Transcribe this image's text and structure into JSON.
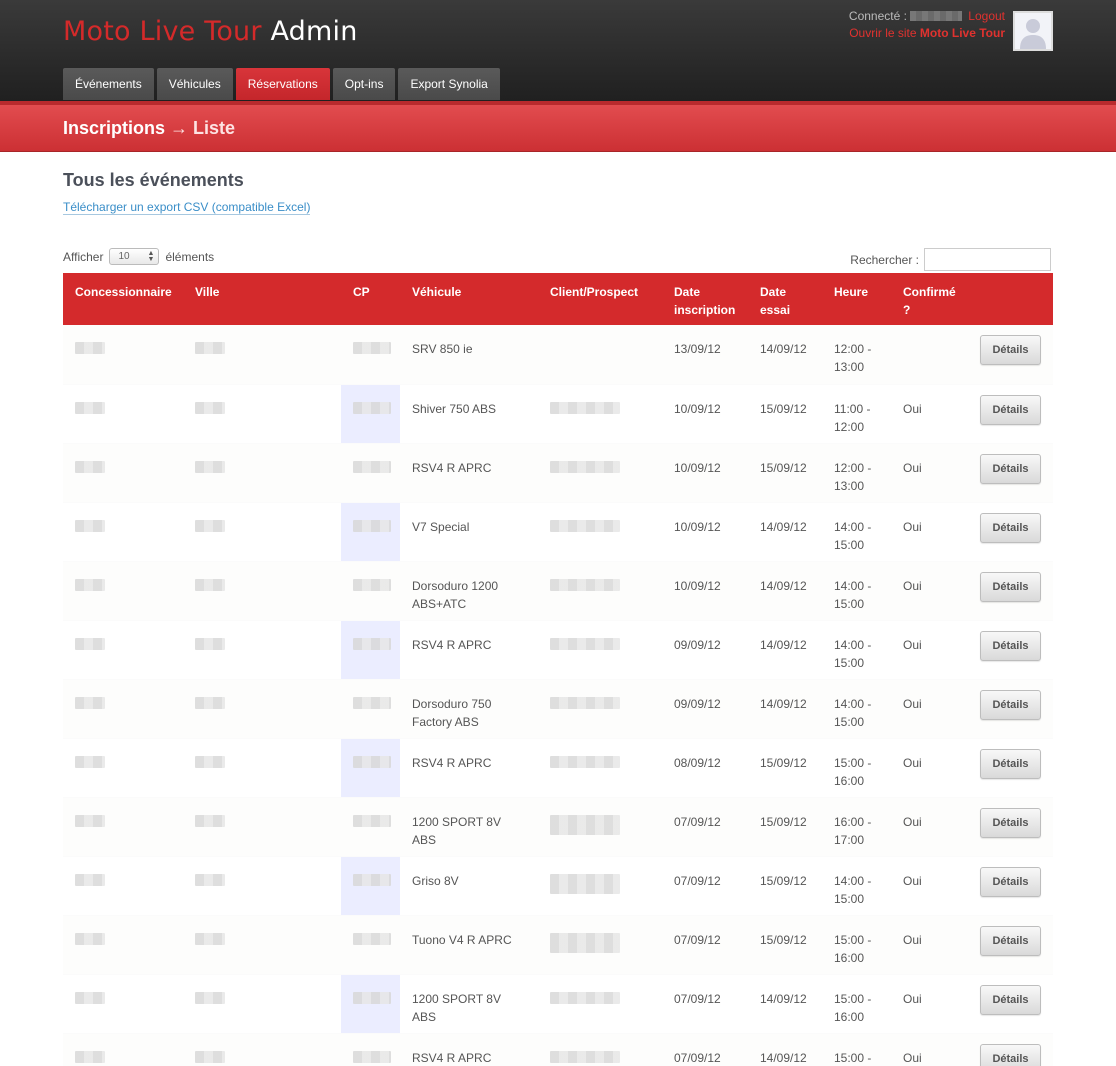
{
  "header": {
    "logo_brand": "Moto Live Tour",
    "logo_suffix": "Admin",
    "connected_label": "Connecté :",
    "logout_label": "Logout",
    "open_site_prefix": "Ouvrir le site",
    "open_site_name": "Moto Live Tour"
  },
  "nav": {
    "tabs": [
      {
        "label": "Événements",
        "active": false
      },
      {
        "label": "Véhicules",
        "active": false
      },
      {
        "label": "Réservations",
        "active": true
      },
      {
        "label": "Opt-ins",
        "active": false
      },
      {
        "label": "Export Synolia",
        "active": false
      }
    ]
  },
  "band": {
    "title": "Inscriptions",
    "arrow": "→",
    "subtitle": "Liste"
  },
  "section": {
    "title": "Tous les événements",
    "csv_link": "Télécharger un export CSV (compatible Excel)"
  },
  "controls": {
    "show_label": "Afficher",
    "show_value": "10",
    "items_label": "éléments",
    "search_label": "Rechercher :"
  },
  "table": {
    "columns": [
      "Concessionnaire",
      "Ville",
      "CP",
      "Véhicule",
      "Client/Prospect",
      "Date inscription",
      "Date essai",
      "Heure",
      "Confirmé ?",
      ""
    ],
    "details_label": "Détails",
    "rows": [
      {
        "vehicle": "SRV 850 ie",
        "date_inscription": "13/09/12",
        "date_essai": "14/09/12",
        "heure": "12:00 - 13:00",
        "confirme": "",
        "client_hidden": false
      },
      {
        "vehicle": "Shiver 750 ABS",
        "date_inscription": "10/09/12",
        "date_essai": "15/09/12",
        "heure": "11:00 - 12:00",
        "confirme": "Oui",
        "client_hidden": true
      },
      {
        "vehicle": "RSV4 R APRC",
        "date_inscription": "10/09/12",
        "date_essai": "15/09/12",
        "heure": "12:00 - 13:00",
        "confirme": "Oui",
        "client_hidden": true
      },
      {
        "vehicle": "V7 Special",
        "date_inscription": "10/09/12",
        "date_essai": "14/09/12",
        "heure": "14:00 - 15:00",
        "confirme": "Oui",
        "client_hidden": true
      },
      {
        "vehicle": "Dorsoduro 1200 ABS+ATC",
        "date_inscription": "10/09/12",
        "date_essai": "14/09/12",
        "heure": "14:00 - 15:00",
        "confirme": "Oui",
        "client_hidden": true
      },
      {
        "vehicle": "RSV4 R APRC",
        "date_inscription": "09/09/12",
        "date_essai": "14/09/12",
        "heure": "14:00 - 15:00",
        "confirme": "Oui",
        "client_hidden": true
      },
      {
        "vehicle": "Dorsoduro 750 Factory ABS",
        "date_inscription": "09/09/12",
        "date_essai": "14/09/12",
        "heure": "14:00 - 15:00",
        "confirme": "Oui",
        "client_hidden": true
      },
      {
        "vehicle": "RSV4 R APRC",
        "date_inscription": "08/09/12",
        "date_essai": "15/09/12",
        "heure": "15:00 - 16:00",
        "confirme": "Oui",
        "client_hidden": true
      },
      {
        "vehicle": "1200 SPORT 8V ABS",
        "date_inscription": "07/09/12",
        "date_essai": "15/09/12",
        "heure": "16:00 - 17:00",
        "confirme": "Oui",
        "client_hidden": true
      },
      {
        "vehicle": "Griso 8V",
        "date_inscription": "07/09/12",
        "date_essai": "15/09/12",
        "heure": "14:00 - 15:00",
        "confirme": "Oui",
        "client_hidden": true
      },
      {
        "vehicle": "Tuono V4 R APRC",
        "date_inscription": "07/09/12",
        "date_essai": "15/09/12",
        "heure": "15:00 - 16:00",
        "confirme": "Oui",
        "client_hidden": true
      },
      {
        "vehicle": "1200 SPORT 8V ABS",
        "date_inscription": "07/09/12",
        "date_essai": "14/09/12",
        "heure": "15:00 - 16:00",
        "confirme": "Oui",
        "client_hidden": true
      },
      {
        "vehicle": "RSV4 R APRC",
        "date_inscription": "07/09/12",
        "date_essai": "14/09/12",
        "heure": "15:00 -",
        "confirme": "Oui",
        "client_hidden": true
      }
    ]
  },
  "colors": {
    "accent": "#d42a2c",
    "header_bg": "#2a2a2a",
    "link": "#3a8ec8"
  }
}
